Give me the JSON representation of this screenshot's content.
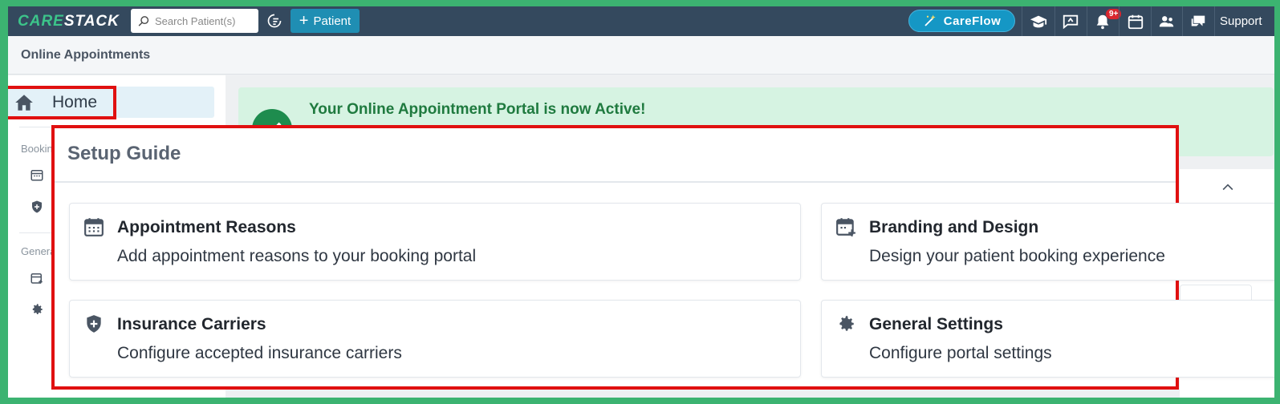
{
  "topbar": {
    "logo_care": "CARE",
    "logo_stack": "STACK",
    "search_placeholder": "Search Patient(s)",
    "add_patient_label": "Patient",
    "careflow_label": "CareFlow",
    "notification_badge": "9+",
    "support_label": "Support"
  },
  "subheader": {
    "title": "Online Appointments"
  },
  "sidebar": {
    "home_label": "Home",
    "section_booking": "Booking",
    "section_general": "General"
  },
  "banner": {
    "message": "Your Online Appointment Portal is now Active!"
  },
  "setup_guide": {
    "title": "Setup Guide",
    "cards": [
      {
        "title": "Appointment Reasons",
        "description": "Add appointment reasons to your booking portal",
        "icon": "calendar-icon"
      },
      {
        "title": "Branding and Design",
        "description": "Design your patient booking experience",
        "icon": "calendar-plus-icon"
      },
      {
        "title": "Insurance Carriers",
        "description": "Configure accepted insurance carriers",
        "icon": "shield-plus-icon"
      },
      {
        "title": "General Settings",
        "description": "Configure portal settings",
        "icon": "gear-icon"
      }
    ]
  },
  "colors": {
    "topbar": "#34495e",
    "accent": "#1f8eb3",
    "highlight": "#e01010",
    "success": "#1e8c4e"
  }
}
